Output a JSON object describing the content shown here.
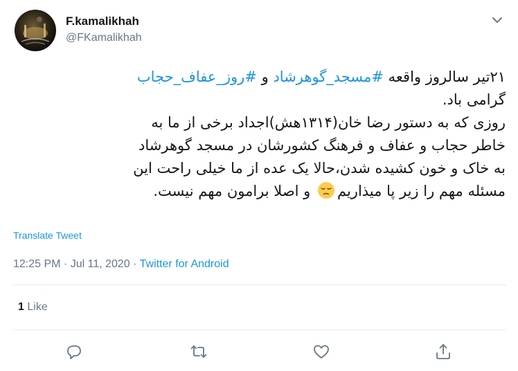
{
  "user": {
    "display_name": "F.kamalikhah",
    "handle": "@FKamalikhah"
  },
  "tweet": {
    "line1": {
      "text_a": "۲۱تیر سالروز واقعه ",
      "hashtag_1": "#مسجد_گوهرشاد",
      "text_b": " و ",
      "hashtag_2": "#روز_عفاف_حجاب"
    },
    "line2": "گرامی باد.",
    "line3": "روزی که به دستور رضا خان(۱۳۱۴هش)اجداد برخی از ما به",
    "line4": "خاطر حجاب و عفاف و فرهنگ کشورشان در مسجد گوهرشاد",
    "line5": "به خاک و خون کشیده شدن،حالا یک عده از ما خیلی راحت این",
    "line6": {
      "text_a": "مسئله مهم را زیر پا میذاریم",
      "text_b": " و اصلا برامون مهم نیست.",
      "emoji": "pensive-face-emoji"
    }
  },
  "translate_label": "Translate Tweet",
  "meta": {
    "time": "12:25 PM",
    "separator": " · ",
    "date": "Jul 11, 2020",
    "source": "Twitter for Android"
  },
  "stats": {
    "likes_count": "1",
    "likes_label": "Like"
  },
  "actions": [
    "reply-icon",
    "retweet-icon",
    "like-icon",
    "share-icon"
  ],
  "colors": {
    "link": "#1b95e0",
    "secondary": "#657786",
    "primary_text": "#14171a",
    "divider": "#e6ecf0"
  }
}
